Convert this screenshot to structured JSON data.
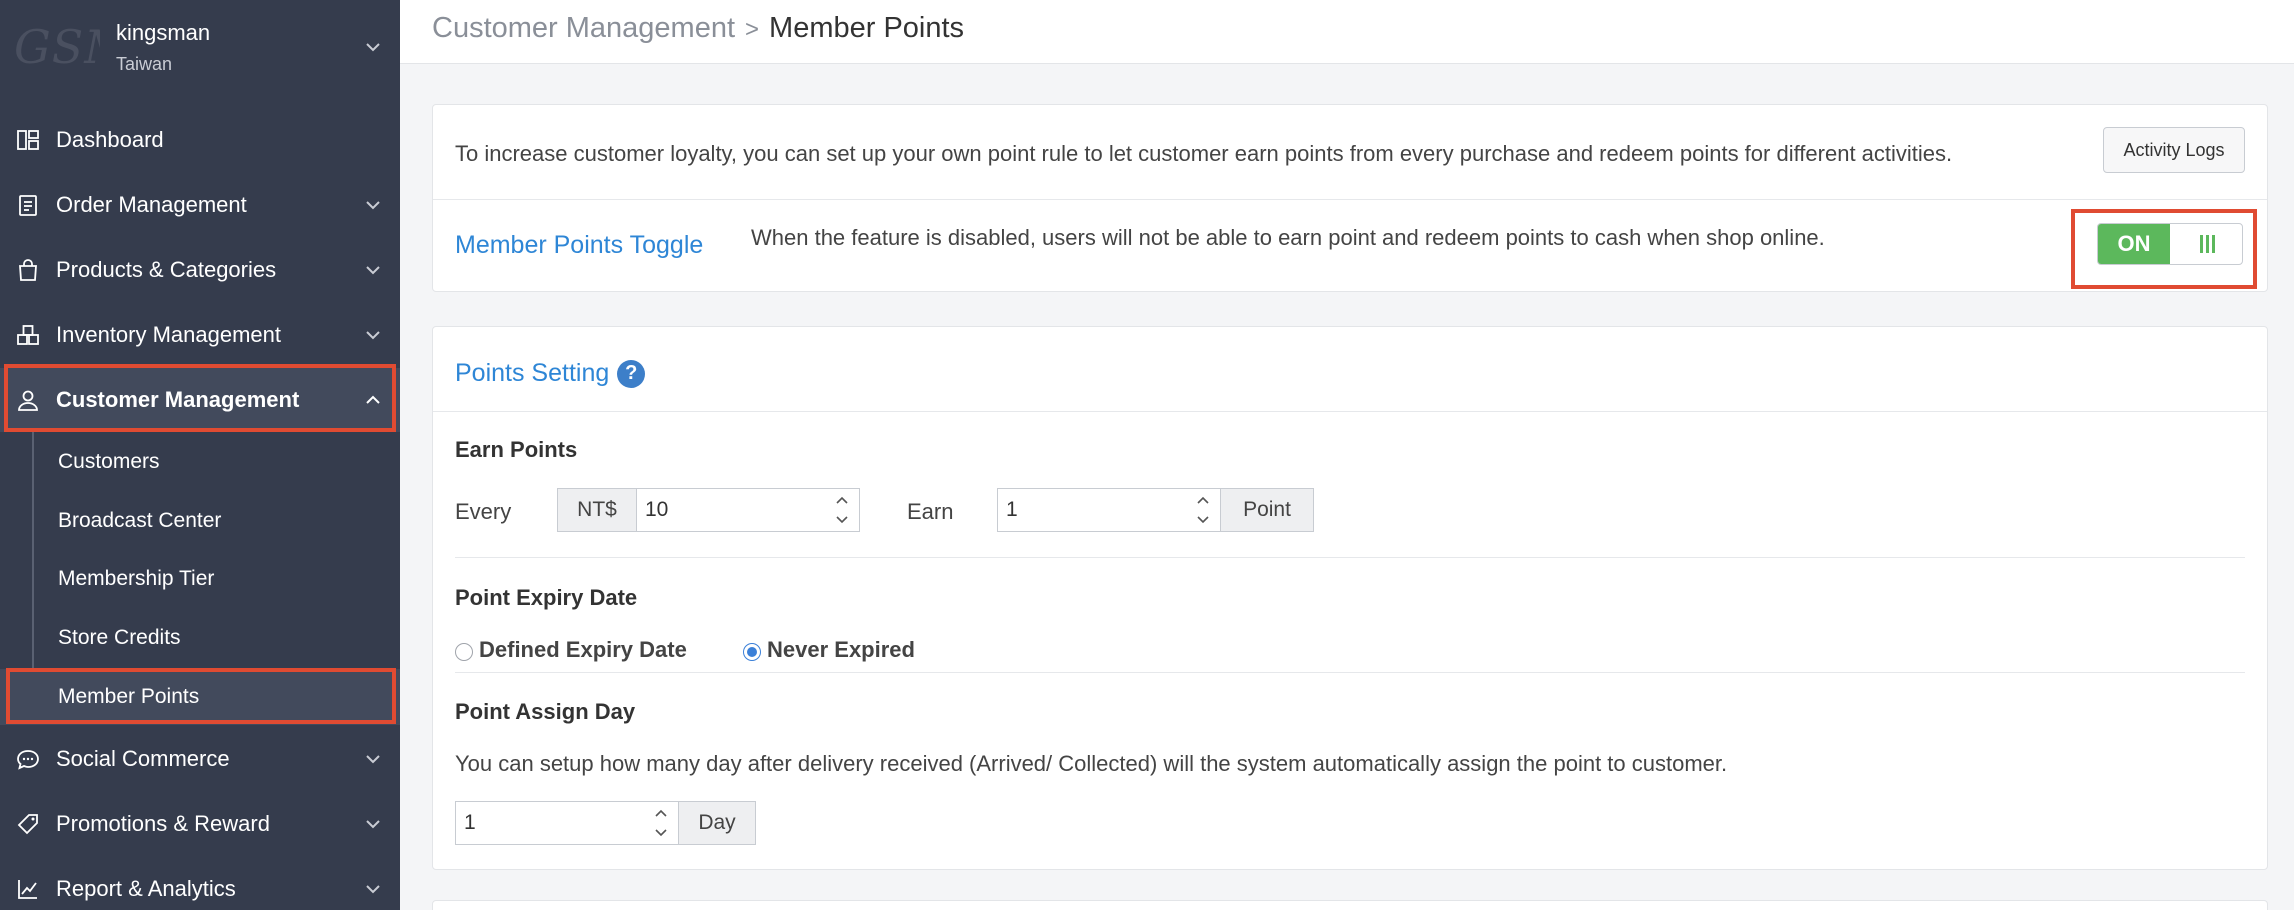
{
  "shop": {
    "logo_text": "GSM",
    "name": "kingsman",
    "region": "Taiwan"
  },
  "sidebar": {
    "items": [
      {
        "label": "Dashboard"
      },
      {
        "label": "Order Management"
      },
      {
        "label": "Products & Categories"
      },
      {
        "label": "Inventory Management"
      },
      {
        "label": "Customer Management"
      },
      {
        "label": "Social Commerce"
      },
      {
        "label": "Promotions & Reward"
      },
      {
        "label": "Report & Analytics"
      }
    ],
    "sub_items": [
      {
        "label": "Customers"
      },
      {
        "label": "Broadcast Center"
      },
      {
        "label": "Membership Tier"
      },
      {
        "label": "Store Credits"
      },
      {
        "label": "Member Points"
      }
    ]
  },
  "header": {
    "breadcrumb_parent": "Customer Management",
    "breadcrumb_current": "Member Points"
  },
  "intro": {
    "text": "To increase customer loyalty, you can set up your own point rule to let customer earn points from every purchase and redeem points for different activities.",
    "activity_logs_label": "Activity Logs"
  },
  "toggle": {
    "title": "Member Points Toggle",
    "description": "When the feature is disabled, users will not be able to earn point and redeem points to cash when shop online.",
    "state_label": "ON"
  },
  "points_setting": {
    "title": "Points Setting",
    "help_glyph": "?",
    "earn": {
      "title": "Earn Points",
      "every_label": "Every",
      "currency": "NT$",
      "amount": "10",
      "earn_label": "Earn",
      "points": "1",
      "point_unit": "Point"
    },
    "expiry": {
      "title": "Point Expiry Date",
      "option_defined": "Defined Expiry Date",
      "option_never": "Never Expired",
      "selected": "never"
    },
    "assign": {
      "title": "Point Assign Day",
      "description": "You can setup how many day after delivery received (Arrived/ Collected) will the system automatically assign the point to customer.",
      "days": "1",
      "day_unit": "Day"
    }
  },
  "colors": {
    "sidebar_bg": "#353c4d",
    "accent_blue": "#2e86d6",
    "toggle_green": "#5cb85c",
    "highlight_red": "#e04b32"
  }
}
